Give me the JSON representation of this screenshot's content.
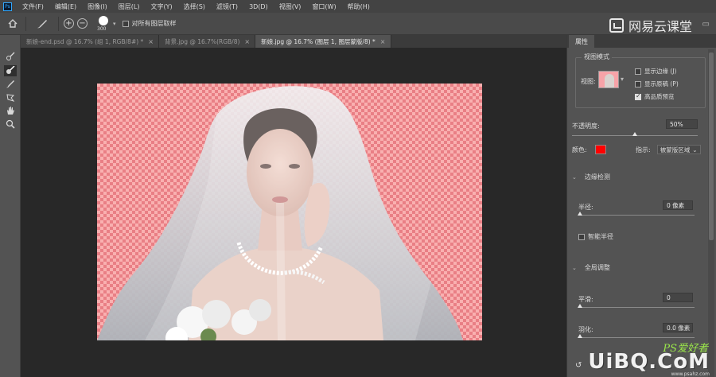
{
  "app": {
    "logo": "Ps"
  },
  "menu": [
    "文件(F)",
    "编辑(E)",
    "图像(I)",
    "图层(L)",
    "文字(Y)",
    "选择(S)",
    "滤镜(T)",
    "3D(D)",
    "视图(V)",
    "窗口(W)",
    "帮助(H)"
  ],
  "options_bar": {
    "brush_size": "300",
    "sample_all_layers_label": "对所有图层取样",
    "sample_all_layers_checked": false
  },
  "watermark_top": {
    "text": "网易云课堂"
  },
  "tabs": [
    {
      "label": "新娘-end.psd @ 16.7% (组 1, RGB/8#) *",
      "active": false
    },
    {
      "label": "背景.jpg @ 16.7%(RGB/8)",
      "active": false
    },
    {
      "label": "新娘.jpg @ 16.7% (图层 1, 图层蒙版/8) *",
      "active": true
    }
  ],
  "tools": [
    "quick-selection-icon",
    "refine-edge-brush-icon",
    "brush-icon",
    "lasso-icon",
    "hand-icon",
    "zoom-icon"
  ],
  "properties": {
    "tab_label": "属性",
    "view_mode": {
      "title": "视图模式",
      "view_label": "视图:",
      "show_edge_label": "显示边缘 (J)",
      "show_edge_checked": false,
      "show_original_label": "显示原稿 (P)",
      "show_original_checked": false,
      "hq_preview_label": "高品质预览",
      "hq_preview_checked": true
    },
    "opacity": {
      "label": "不透明度:",
      "value": "50%",
      "level": 0.5
    },
    "color": {
      "label": "颜色:",
      "value": "#ff0000"
    },
    "indicate": {
      "label": "指示:",
      "value": "被蒙版区域"
    },
    "edge_detection": {
      "title": "边缘检测",
      "radius_label": "半径:",
      "radius_value": "0 像素",
      "radius_level": 0,
      "smart_radius_label": "智能半径",
      "smart_radius_checked": false
    },
    "global_refinements": {
      "title": "全局调整",
      "smooth_label": "平滑:",
      "smooth_value": "0",
      "smooth_level": 0,
      "feather_label": "羽化:",
      "feather_value": "0.0 像素",
      "feather_level": 0
    }
  },
  "watermark_bottom": {
    "brand": "UiBQ.CoM",
    "ps_text": "PS爱好者",
    "url": "www.psahz.com"
  }
}
